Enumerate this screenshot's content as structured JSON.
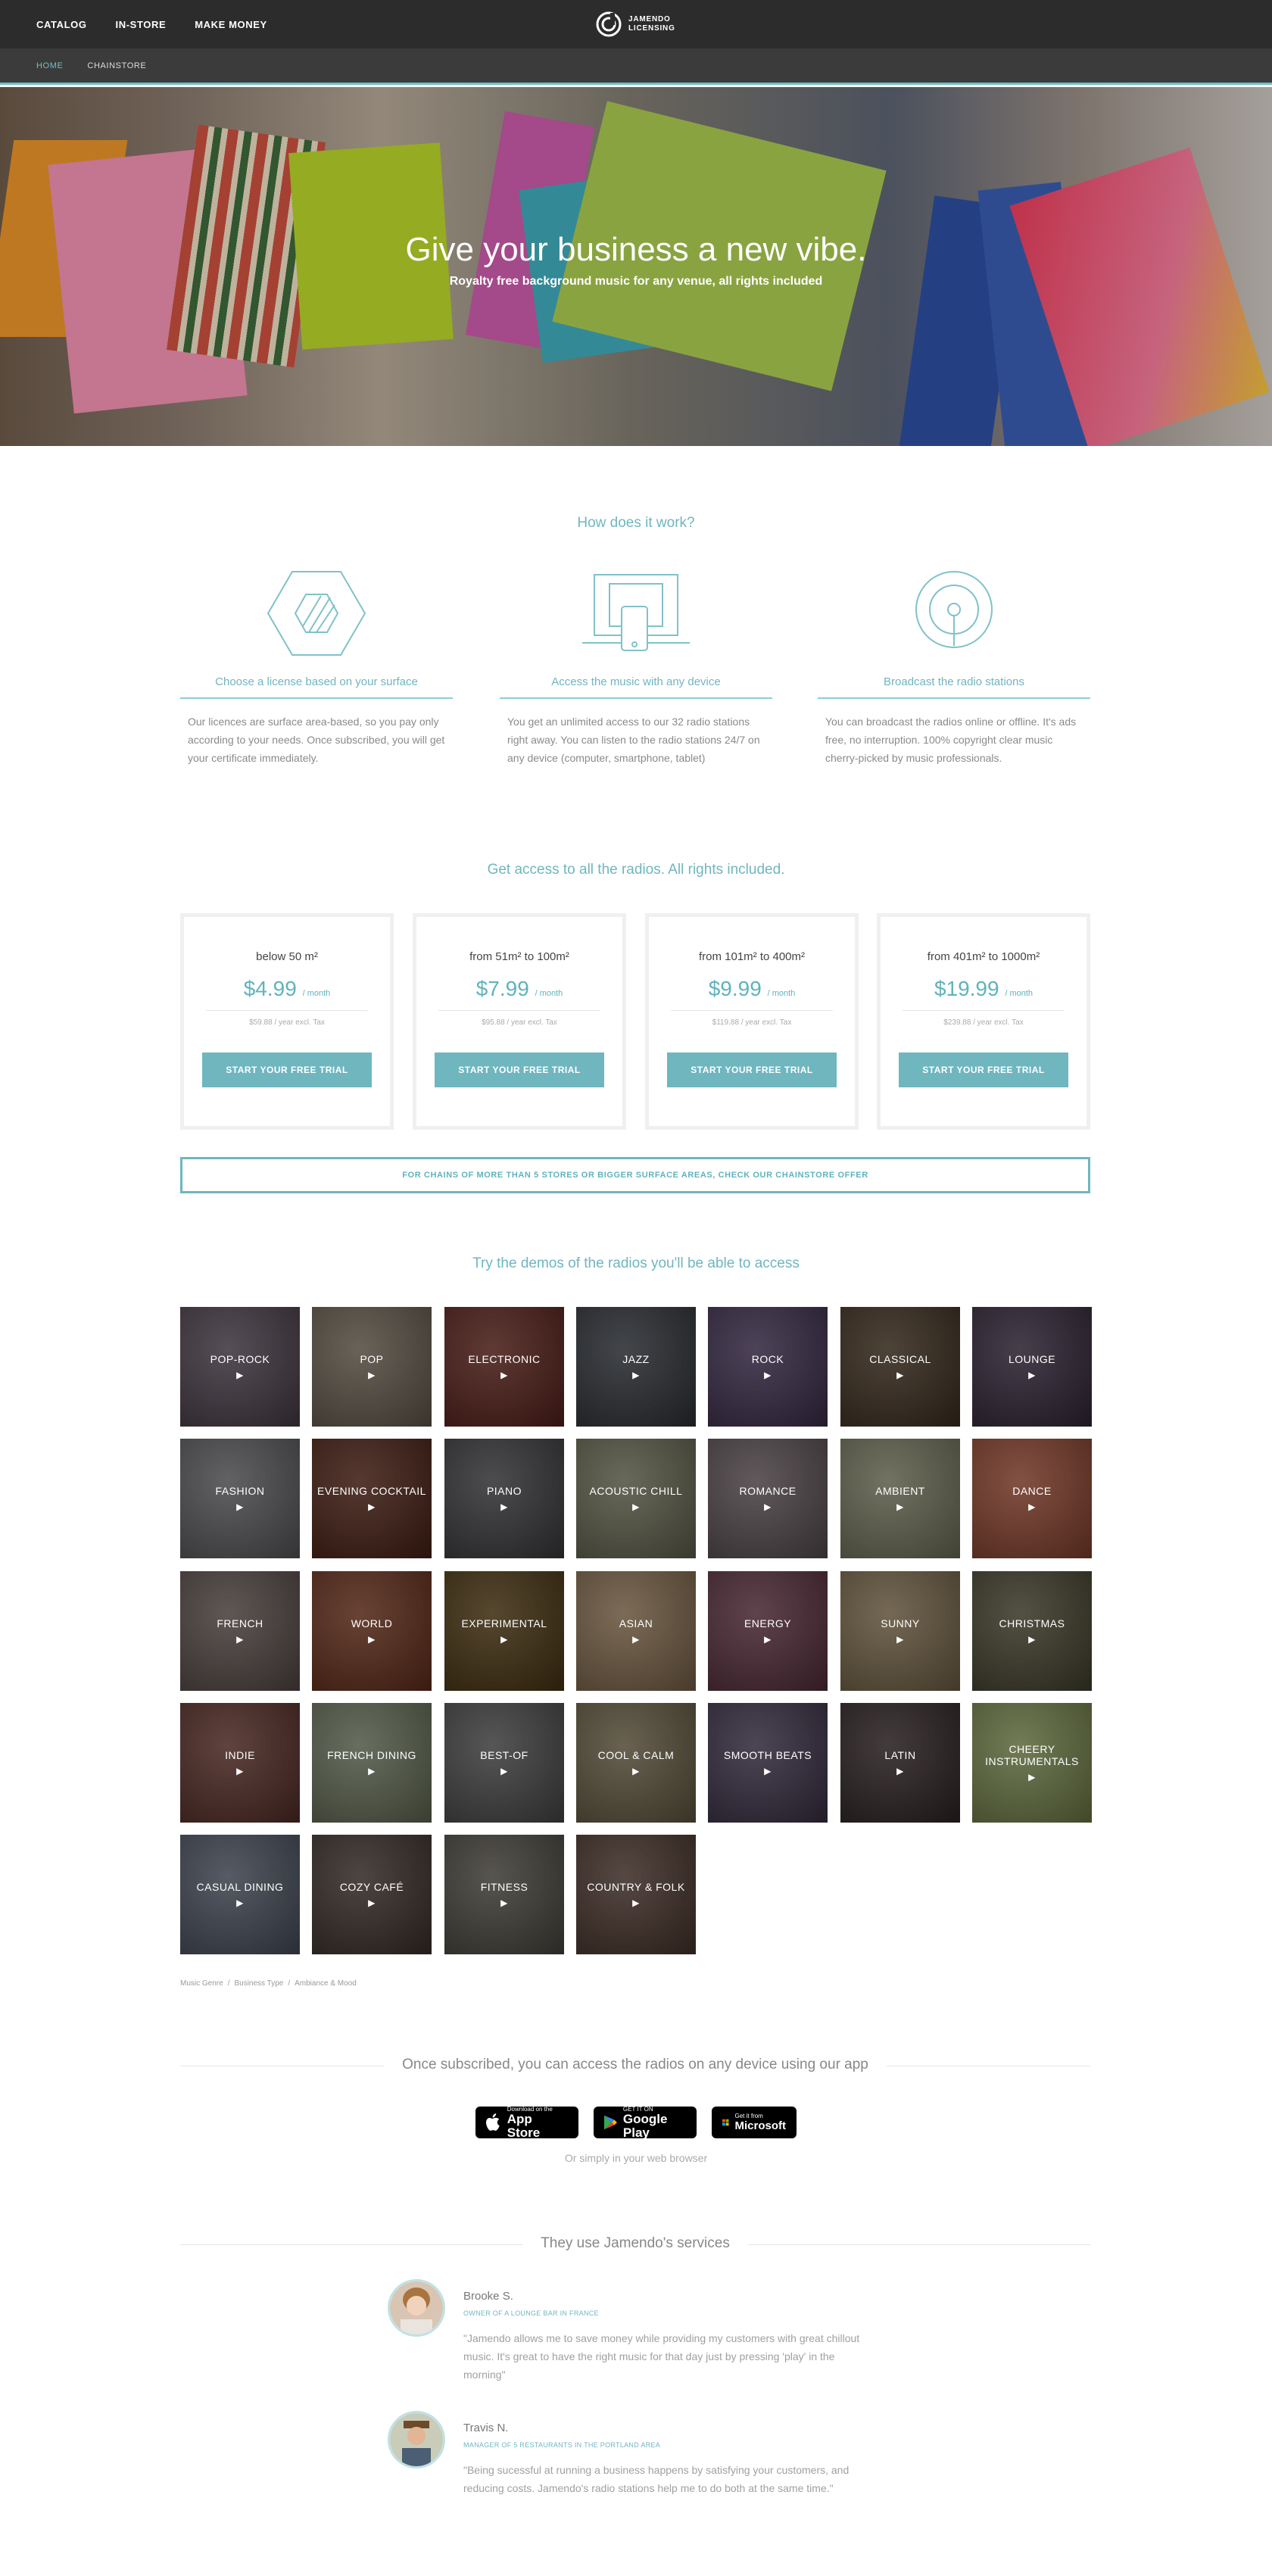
{
  "topnav": {
    "items": [
      "CATALOG",
      "IN-STORE",
      "MAKE MONEY"
    ],
    "logo_line1": "JAMENDO",
    "logo_line2": "LICENSING"
  },
  "subnav": {
    "items": [
      "HOME",
      "CHAINSTORE"
    ],
    "active": "HOME"
  },
  "hero": {
    "title": "Give your business a new vibe.",
    "subtitle": "Royalty free background music for any venue, all rights included"
  },
  "how": {
    "title": "How does it work?",
    "steps": [
      {
        "icon": "hexagon-license-icon",
        "title": "Choose a license based on your surface",
        "text": "Our licences are surface area-based, so you pay only according to your needs. Once subscribed, you will get your certificate immediately."
      },
      {
        "icon": "devices-icon",
        "title": "Access the music with any device",
        "text": "You get an unlimited access to our 32 radio stations right away. You can listen to the radio stations 24/7 on any device (computer, smartphone, tablet)"
      },
      {
        "icon": "radio-broadcast-icon",
        "title": "Broadcast the radio stations",
        "text": "You can broadcast the radios online or offline. It's ads free, no interruption. 100% copyright clear music cherry-picked by music professionals."
      }
    ]
  },
  "pricing": {
    "title": "Get access to all the radios. All rights included.",
    "plans": [
      {
        "range": "below 50 m²",
        "price": "$4.99",
        "unit": "/ month",
        "yearly": "$59.88 / year excl. Tax",
        "cta": "START YOUR FREE TRIAL"
      },
      {
        "range": "from 51m² to 100m²",
        "price": "$7.99",
        "unit": "/ month",
        "yearly": "$95.88 / year excl. Tax",
        "cta": "START YOUR FREE TRIAL"
      },
      {
        "range": "from 101m² to 400m²",
        "price": "$9.99",
        "unit": "/ month",
        "yearly": "$119.88 / year excl. Tax",
        "cta": "START YOUR FREE TRIAL"
      },
      {
        "range": "from 401m² to 1000m²",
        "price": "$19.99",
        "unit": "/ month",
        "yearly": "$239.88 / year excl. Tax",
        "cta": "START YOUR FREE TRIAL"
      }
    ],
    "chainstore": "FOR CHAINS OF MORE THAN 5 STORES OR BIGGER SURFACE AREAS, CHECK OUR CHAINSTORE OFFER"
  },
  "radios": {
    "title": "Try the demos of the radios you'll be able to access",
    "play_glyph": "▶",
    "items": [
      {
        "label": "POP-ROCK",
        "color": "#5a4d5a"
      },
      {
        "label": "POP",
        "color": "#7b6f5f"
      },
      {
        "label": "ELECTRONIC",
        "color": "#6a2a22"
      },
      {
        "label": "JAZZ",
        "color": "#3b3f46"
      },
      {
        "label": "ROCK",
        "color": "#4b3a5e"
      },
      {
        "label": "CLASSICAL",
        "color": "#4c3a28"
      },
      {
        "label": "LOUNGE",
        "color": "#3f3248"
      },
      {
        "label": "FASHION",
        "color": "#6e6e72"
      },
      {
        "label": "EVENING COCKTAIL",
        "color": "#5a2a1c"
      },
      {
        "label": "PIANO",
        "color": "#4a4a4e"
      },
      {
        "label": "ACOUSTIC CHILL",
        "color": "#7a7a62"
      },
      {
        "label": "ROMANCE",
        "color": "#6c6064"
      },
      {
        "label": "AMBIENT",
        "color": "#8a8a70"
      },
      {
        "label": "DANCE",
        "color": "#a5523a"
      },
      {
        "label": "FRENCH",
        "color": "#6a5c58"
      },
      {
        "label": "WORLD",
        "color": "#7a3a22"
      },
      {
        "label": "EXPERIMENTAL",
        "color": "#5a4218"
      },
      {
        "label": "ASIAN",
        "color": "#9a7e5c"
      },
      {
        "label": "ENERGY",
        "color": "#6a3a4a"
      },
      {
        "label": "SUNNY",
        "color": "#8e7a58"
      },
      {
        "label": "CHRISTMAS",
        "color": "#55523a"
      },
      {
        "label": "INDIE",
        "color": "#6a3a32"
      },
      {
        "label": "FRENCH DINING",
        "color": "#7a846a"
      },
      {
        "label": "BEST-OF",
        "color": "#5a5a5a"
      },
      {
        "label": "COOL & CALM",
        "color": "#7a6e52"
      },
      {
        "label": "SMOOTH BEATS",
        "color": "#4a3e58"
      },
      {
        "label": "LATIN",
        "color": "#3a2e2e"
      },
      {
        "label": "CHEERY INSTRUMENTALS",
        "color": "#8a9a5a"
      },
      {
        "label": "CASUAL DINING",
        "color": "#5a6272"
      },
      {
        "label": "COZY CAFÉ",
        "color": "#4a3e38"
      },
      {
        "label": "FITNESS",
        "color": "#5c5850"
      },
      {
        "label": "COUNTRY & FOLK",
        "color": "#5a4238"
      }
    ]
  },
  "breadcrumb": {
    "items": [
      "Music Genre",
      "Business Type",
      "Ambiance & Mood"
    ],
    "sep": "/"
  },
  "devices": {
    "title": "Once subscribed, you can access the radios on any device using our app",
    "stores": [
      {
        "icon": "apple-icon",
        "top": "Download on the",
        "name": "App Store"
      },
      {
        "icon": "google-play-icon",
        "top": "GET IT ON",
        "name": "Google Play"
      },
      {
        "icon": "windows-icon",
        "top": "Get it from",
        "name": "Microsoft"
      }
    ],
    "browser": "Or simply in your web browser"
  },
  "testimonials": {
    "title": "They use Jamendo's services",
    "items": [
      {
        "name": "Brooke S.",
        "role": "OWNER OF A LOUNGE BAR IN FRANCE",
        "quote": "\"Jamendo allows me to save money while providing my customers with great chillout music. It's great to have the right music for that day just by pressing 'play' in the morning\""
      },
      {
        "name": "Travis N.",
        "role": "MANAGER OF 5 RESTAURANTS IN THE PORTLAND AREA",
        "quote": "\"Being sucessful at running a business happens by satisfying your customers, and reducing costs. Jamendo's radio stations help me to do both at the same time.\""
      }
    ]
  },
  "colors": {
    "accent": "#6fb6bf",
    "nav": "#2c2c2c",
    "subnav": "#3b3b3b"
  }
}
